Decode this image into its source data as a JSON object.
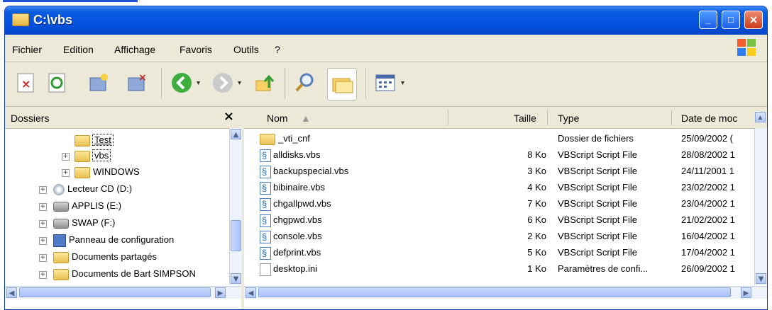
{
  "window": {
    "title": "C:\\vbs"
  },
  "menu": [
    "Fichier",
    "Edition",
    "Affichage",
    "Favoris",
    "Outils",
    "?"
  ],
  "toolbar": {
    "buttons": [
      "delete-icon",
      "refresh-icon",
      "copy-to-icon",
      "move-to-icon",
      "back-icon",
      "forward-icon",
      "up-folder-icon",
      "search-icon",
      "folders-icon",
      "views-icon"
    ]
  },
  "folders_pane": {
    "title": "Dossiers",
    "close": "×",
    "items": [
      {
        "label": "Test",
        "icon": "folder-icon"
      },
      {
        "label": "vbs",
        "icon": "folder-icon"
      },
      {
        "label": "WINDOWS",
        "icon": "folder-icon"
      },
      {
        "label": "Lecteur CD (D:)",
        "icon": "cd-drive-icon"
      },
      {
        "label": "APPLIS (E:)",
        "icon": "network-drive-icon"
      },
      {
        "label": "SWAP (F:)",
        "icon": "network-drive-icon"
      },
      {
        "label": "Panneau de configuration",
        "icon": "control-panel-icon"
      },
      {
        "label": "Documents partagés",
        "icon": "folder-icon"
      },
      {
        "label": "Documents de Bart SIMPSON",
        "icon": "folder-icon"
      }
    ]
  },
  "files": {
    "columns": [
      "Nom",
      "Taille",
      "Type",
      "Date de moc"
    ],
    "rows": [
      {
        "name": "_vti_cnf",
        "size": "",
        "type": "Dossier de fichiers",
        "date": "25/09/2002 (",
        "icon": "folder-icon"
      },
      {
        "name": "alldisks.vbs",
        "size": "8 Ko",
        "type": "VBScript Script File",
        "date": "28/08/2002 1",
        "icon": "vbs-icon"
      },
      {
        "name": "backupspecial.vbs",
        "size": "3 Ko",
        "type": "VBScript Script File",
        "date": "24/11/2001 1",
        "icon": "vbs-icon"
      },
      {
        "name": "bibinaire.vbs",
        "size": "4 Ko",
        "type": "VBScript Script File",
        "date": "23/02/2002 1",
        "icon": "vbs-icon"
      },
      {
        "name": "chgallpwd.vbs",
        "size": "7 Ko",
        "type": "VBScript Script File",
        "date": "23/04/2002 1",
        "icon": "vbs-icon"
      },
      {
        "name": "chgpwd.vbs",
        "size": "6 Ko",
        "type": "VBScript Script File",
        "date": "21/02/2002 1",
        "icon": "vbs-icon"
      },
      {
        "name": "console.vbs",
        "size": "2 Ko",
        "type": "VBScript Script File",
        "date": "16/04/2002 1",
        "icon": "vbs-icon"
      },
      {
        "name": "defprint.vbs",
        "size": "5 Ko",
        "type": "VBScript Script File",
        "date": "17/04/2002 1",
        "icon": "vbs-icon"
      },
      {
        "name": "desktop.ini",
        "size": "1 Ko",
        "type": "Paramètres de confi...",
        "date": "26/09/2002 1",
        "icon": "ini-icon"
      }
    ]
  },
  "colors": {
    "title_bar": "#0352e0",
    "selection_blue": "#316ac5",
    "chrome": "#ece9d8"
  }
}
